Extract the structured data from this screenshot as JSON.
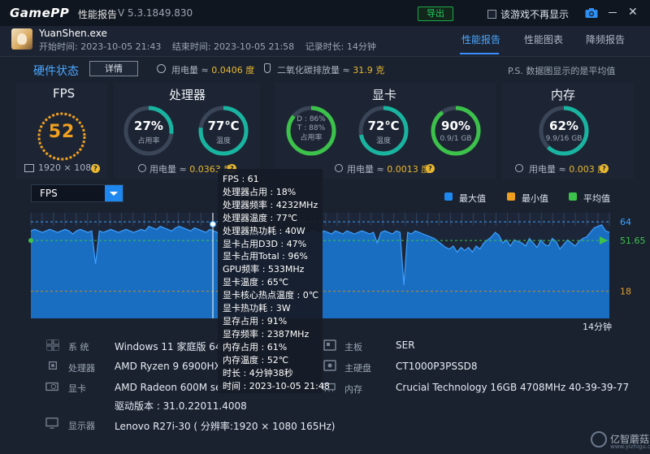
{
  "titlebar": {
    "logo": "GamePP",
    "title": "性能报告",
    "version": "V 5.3.1849.830",
    "export_label": "导出",
    "hide_checkbox_label": "该游戏不再显示",
    "close_glyph": "✕"
  },
  "header": {
    "process_name": "YuanShen.exe",
    "start_time": "开始时间: 2023-10-05 21:43",
    "end_time": "结束时间: 2023-10-05 21:58",
    "duration": "记录时长: 14分钟",
    "tabs": [
      {
        "label": "性能报告",
        "active": true
      },
      {
        "label": "性能图表",
        "active": false
      },
      {
        "label": "降频报告",
        "active": false
      }
    ]
  },
  "hardware_status": {
    "title": "硬件状态",
    "detail_button": "详情",
    "power_prefix": "用电量 ≈ ",
    "power_value": "0.0406 度",
    "co2_prefix": "二氧化碳排放量 ≈ ",
    "co2_value": "31.9 克",
    "note": "P.S. 数据图显示的是平均值"
  },
  "panels": {
    "fps": {
      "title": "FPS",
      "value": "52",
      "resolution": "1920 × 1080"
    },
    "cpu": {
      "title": "处理器",
      "usage": {
        "value": "27%",
        "label": "占用率",
        "fraction": 0.27
      },
      "temp": {
        "value": "77℃",
        "label": "温度",
        "fraction": 0.77
      },
      "power_prefix": "用电量 ≈ ",
      "power_value": "0.0363 度"
    },
    "gpu": {
      "title": "显卡",
      "d_usage": "D : 86%",
      "t_usage": "T : 88%",
      "usage_label": "占用率",
      "usage_fraction": 0.86,
      "temp": {
        "value": "72℃",
        "label": "温度",
        "fraction": 0.72
      },
      "vram": {
        "value": "90%",
        "label": "0.9/1 GB",
        "fraction": 0.9
      },
      "power_prefix": "用电量 ≈ ",
      "power_value": "0.0013 度"
    },
    "ram": {
      "title": "内存",
      "usage": {
        "value": "62%",
        "label": "9.9/16 GB",
        "fraction": 0.62
      },
      "power_prefix": "用电量 ≈ ",
      "power_value": "0.003 度"
    }
  },
  "chart": {
    "metric": "FPS",
    "legend": [
      {
        "label": "最大值",
        "color": "#1e88ef"
      },
      {
        "label": "最小值",
        "color": "#f0a020"
      },
      {
        "label": "平均值",
        "color": "#3cc24a"
      }
    ],
    "duration_label": "14分钟"
  },
  "chart_data": {
    "type": "area",
    "title": "",
    "xlabel": "",
    "ylabel": "FPS",
    "ylim": [
      0,
      70
    ],
    "max": 64,
    "min": 18,
    "avg": 51.65,
    "max_label": "64",
    "min_label": "18",
    "avg_label": "51.65",
    "series": [
      {
        "name": "FPS",
        "values": [
          58,
          59,
          58,
          57,
          58,
          59,
          58,
          57,
          58,
          59,
          58,
          56,
          58,
          59,
          58,
          57,
          58,
          36,
          58,
          57,
          58,
          59,
          58,
          57,
          58,
          59,
          58,
          57,
          58,
          59,
          58,
          61,
          60,
          59,
          61,
          60,
          59,
          58,
          60,
          61,
          60,
          59,
          58,
          60,
          59,
          58,
          57,
          59,
          58,
          57,
          54,
          58,
          57,
          53,
          58,
          56,
          58,
          57,
          56,
          58,
          57,
          56,
          58,
          57,
          55,
          58,
          57,
          56,
          58,
          57,
          56,
          58,
          57,
          56,
          58,
          57,
          56,
          58,
          57,
          56,
          58,
          57,
          56,
          58,
          57,
          56,
          57,
          58,
          57,
          56,
          57,
          50,
          57,
          58,
          57,
          56,
          58,
          57,
          22,
          57,
          56,
          58,
          57,
          56,
          55,
          54,
          53,
          51,
          49,
          47,
          46,
          48,
          44,
          47,
          45,
          47,
          44,
          48,
          46,
          50,
          52,
          54,
          57,
          55,
          50,
          52,
          48,
          52,
          51,
          50,
          48,
          53,
          50,
          47,
          52,
          49,
          48,
          53,
          51,
          46,
          49,
          52,
          50,
          48,
          51,
          53,
          54,
          57,
          60,
          61,
          62,
          58,
          57
        ]
      }
    ]
  },
  "tooltip": {
    "lines": [
      "FPS : 61",
      "处理器占用 : 18%",
      "处理器频率 : 4232MHz",
      "处理器温度 : 77℃",
      "处理器热功耗 : 40W",
      "显卡占用D3D : 47%",
      "显卡占用Total : 96%",
      "GPU频率 : 533MHz",
      "显卡温度 : 65℃",
      "显卡核心热点温度 : 0℃",
      "显卡热功耗 : 3W",
      "显存占用 : 91%",
      "显存频率 : 2387MHz",
      "内存占用 : 61%",
      "内存温度 : 52℃",
      "时长 : 4分钟38秒",
      "时间 : 2023-10-05 21:48"
    ]
  },
  "hw_info": {
    "system": {
      "label": "系  统",
      "value": "Windows 11 家庭版 64位 2"
    },
    "cpu": {
      "label": "处理器",
      "value": "AMD Ryzen 9 6900HX"
    },
    "gpu": {
      "label": "显卡",
      "value": "AMD Radeon 600M series",
      "driver": "驱动版本 : 31.0.22011.4008"
    },
    "display": {
      "label": "显示器",
      "value": "Lenovo R27i-30 ( 分辨率:1920 × 1080 165Hz)"
    },
    "motherboard": {
      "label": "主板",
      "value": "SER"
    },
    "disk": {
      "label": "主硬盘",
      "value": "CT1000P3PSSD8"
    },
    "memory": {
      "label": "内存",
      "value": "Crucial Technology 16GB 4708MHz 40-39-39-77"
    }
  },
  "watermark": {
    "text": "亿智蘑菇",
    "url": "www.yizhigu.com"
  }
}
